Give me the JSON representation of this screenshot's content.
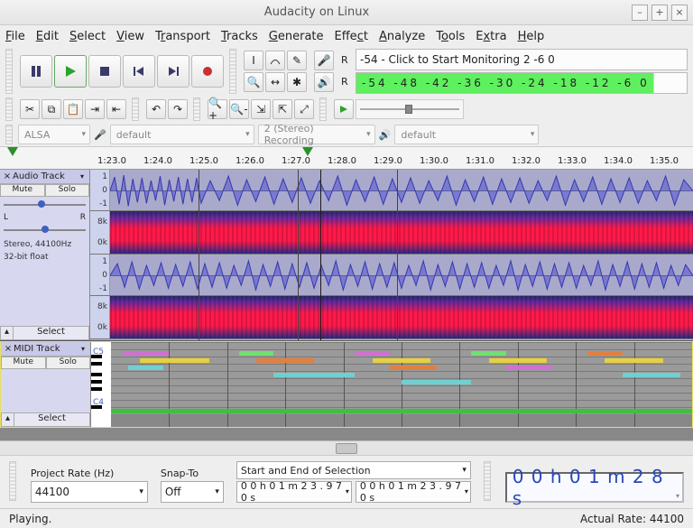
{
  "window": {
    "title": "Audacity on Linux"
  },
  "menu": [
    "File",
    "Edit",
    "Select",
    "View",
    "Transport",
    "Tracks",
    "Generate",
    "Effect",
    "Analyze",
    "Tools",
    "Extra",
    "Help"
  ],
  "transport": {
    "pause": "pause-button",
    "play": "play-button",
    "stop": "stop-button",
    "skip_start": "skip-start-button",
    "skip_end": "skip-end-button",
    "record": "record-button"
  },
  "rec_meter": {
    "label": "R",
    "text": "-54 - Click to Start Monitoring 2  -6   0"
  },
  "play_meter": {
    "label": "R",
    "ticks": "-54 -48 -42 -36 -30 -24 -18 -12  -6   0"
  },
  "device_row": {
    "host": "ALSA",
    "rec_device": "default",
    "channels": "2 (Stereo) Recording",
    "play_device": "default"
  },
  "ruler": {
    "times": [
      "1:23.0",
      "1:24.0",
      "1:25.0",
      "1:26.0",
      "1:27.0",
      "1:28.0",
      "1:29.0",
      "1:30.0",
      "1:31.0",
      "1:32.0",
      "1:33.0",
      "1:34.0",
      "1:35.0"
    ]
  },
  "tracks": {
    "audio": {
      "name": "Audio Track",
      "mute": "Mute",
      "solo": "Solo",
      "pan_l": "L",
      "pan_r": "R",
      "info1": "Stereo, 44100Hz",
      "info2": "32-bit float",
      "select": "Select",
      "wave_scale": [
        "1",
        "0",
        "-1"
      ],
      "spec_scale": [
        "8k",
        "0k"
      ]
    },
    "midi": {
      "name": "MIDI Track",
      "mute": "Mute",
      "solo": "Solo",
      "select": "Select",
      "labels": {
        "top": "C5",
        "bottom": "C4"
      }
    }
  },
  "bottom": {
    "rate_label": "Project Rate (Hz)",
    "rate_value": "44100",
    "snap_label": "Snap-To",
    "snap_value": "Off",
    "selection_label": "Start and End of Selection",
    "sel_start": "0 0 h 0 1 m 2 3 . 9 7 0 s",
    "sel_end": "0 0 h 0 1 m 2 3 . 9 7 0 s",
    "position": "0 0 h 0 1 m 2 8 s"
  },
  "status": {
    "left": "Playing.",
    "right": "Actual Rate: 44100"
  }
}
